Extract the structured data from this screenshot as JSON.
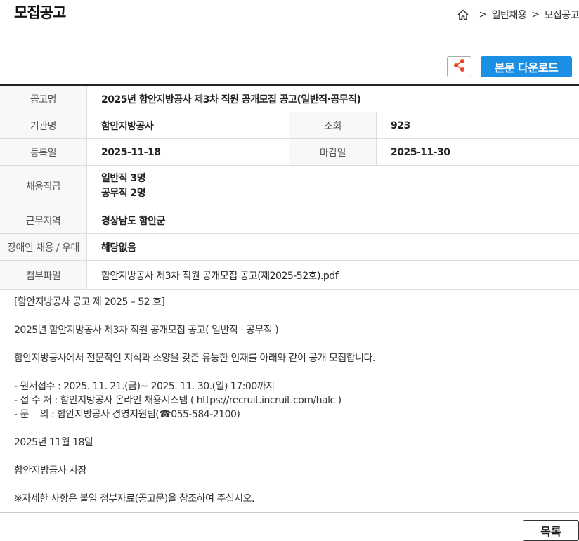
{
  "header": {
    "title": "모집공고",
    "breadcrumb": [
      "일반채용",
      "모집공고"
    ]
  },
  "actions": {
    "download_label": "본문 다운로드",
    "list_label": "목록"
  },
  "colors": {
    "accent": "#1a8fe3",
    "share_icon": "#e8452c"
  },
  "info": {
    "title_label": "공고명",
    "title_value": "2025년 함안지방공사 제3차 직원 공개모집 공고(일반직·공무직)",
    "org_label": "기관명",
    "org_value": "함안지방공사",
    "views_label": "조회",
    "views_value": "923",
    "reg_label": "등록일",
    "reg_value": "2025-11-18",
    "deadline_label": "마감일",
    "deadline_value": "2025-11-30",
    "grade_label": "채용직급",
    "grade_values": [
      "일반직 3명",
      "공무직 2명"
    ],
    "region_label": "근무지역",
    "region_value": "경상남도 함안군",
    "disabled_label": "장애인 채용 / 우대",
    "disabled_value": "해당없음",
    "attach_label": "첨부파일",
    "attach_value": "함안지방공사 제3차 직원 공개모집 공고(제2025-52호).pdf"
  },
  "content": [
    "[함안지방공사 공고 제 2025 – 52 호]",
    "",
    "2025년 함안지방공사 제3차 직원 공개모집 공고( 일반직 · 공무직 )",
    "",
    "함안지방공사에서 전문적인 지식과 소양을 갖춘 유능한 인재를 아래와 같이 공개 모집합니다.",
    "",
    "- 원서접수 : 2025. 11. 21.(금)~ 2025. 11. 30.(일) 17:00까지",
    "- 접 수 처 : 함안지방공사 온라인 채용시스템 ( https://recruit.incruit.com/halc )",
    "- 문    의 : 함안지방공사 경영지원팀(☎055-584-2100)",
    "",
    "2025년 11월 18일",
    "",
    "함안지방공사 사장",
    "",
    "※자세한 사항은 붙임 첨부자료(공고문)을 참조하여 주십시오."
  ]
}
